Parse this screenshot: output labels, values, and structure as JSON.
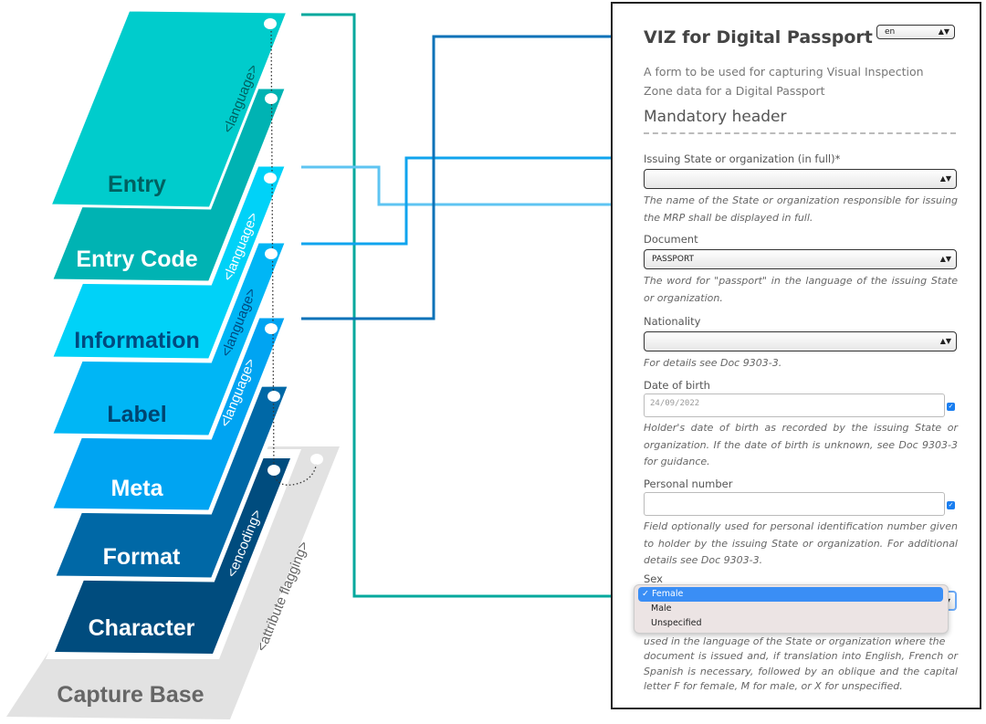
{
  "layers": [
    {
      "name": "Capture Base",
      "fill": "#e2e2e2",
      "text_color": "#666666"
    },
    {
      "name": "Character",
      "fill": "#004c7e",
      "text_color": "#ffffff"
    },
    {
      "name": "Format",
      "fill": "#0068a6",
      "text_color": "#ffffff"
    },
    {
      "name": "Meta",
      "fill": "#00a4f2",
      "text_color": "#ffffff"
    },
    {
      "name": "Label",
      "fill": "#00b6f5",
      "text_color": "#004470"
    },
    {
      "name": "Information",
      "fill": "#00d2f8",
      "text_color": "#004a80"
    },
    {
      "name": "Entry Code",
      "fill": "#00b3b3",
      "text_color": "#ffffff"
    },
    {
      "name": "Entry",
      "fill": "#00cccc",
      "text_color": "#006060"
    }
  ],
  "rotated_labels": {
    "language": "<language>",
    "encoding": "<encoding>",
    "attribute_flagging": "<attribute flagging>"
  },
  "connector_colors": {
    "entry": "#00a89d",
    "entry_code": "#5ec4f2",
    "information": "#10a4ee",
    "label": "#0a72b8"
  },
  "form": {
    "title": "VIZ for Digital Passport",
    "language_select": "en",
    "description": "A form to be used for capturing Visual Inspection Zone data for a Digital Passport",
    "section": "Mandatory header",
    "fields": {
      "issuing_state": {
        "label": "Issuing State or organization (in full)*",
        "value": "",
        "help": "The name of the State or organization responsible for issuing the MRP shall be displayed in full."
      },
      "document": {
        "label": "Document",
        "value": "PASSPORT",
        "help": "The word for \"passport\" in the language of the issuing State or organization."
      },
      "nationality": {
        "label": "Nationality",
        "value": "",
        "help": "For details see Doc 9303-3."
      },
      "date_of_birth": {
        "label": "Date of birth",
        "value": "24/09/2022",
        "help": "Holder's date of birth as recorded by the issuing State or organization. If the date of birth is unknown, see Doc 9303-3 for guidance."
      },
      "personal_number": {
        "label": "Personal number",
        "value": "",
        "help": "Field optionally used for personal identification number given to holder by the issuing State or organization. For additional details see Doc 9303-3."
      },
      "sex": {
        "label": "Sex",
        "options": [
          "Female",
          "Male",
          "Unspecified"
        ],
        "selected": "Female",
        "help_partial": "used in the language of the State or organization where the",
        "help": "document is issued and, if translation into English, French or Spanish is necessary, followed by an oblique and the capital letter F for female, M for male, or X for unspecified."
      }
    }
  }
}
